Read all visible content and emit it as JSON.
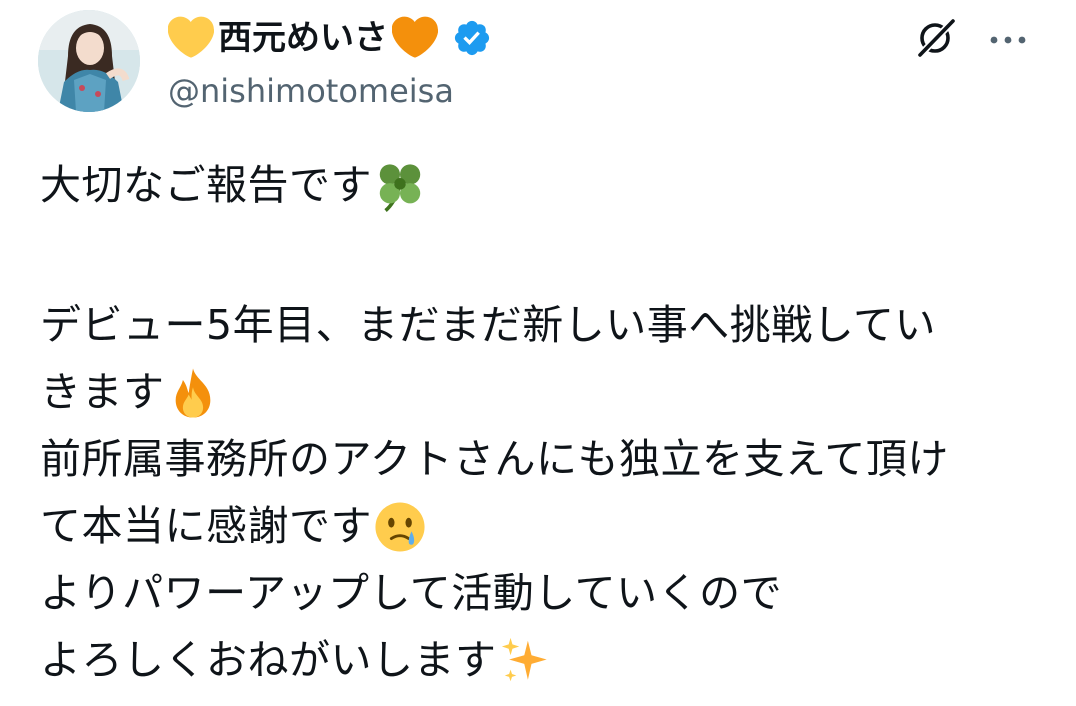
{
  "author": {
    "display_name": "西元めいさ",
    "handle": "@nishimotomeisa",
    "verified": true,
    "heart_left_color": "#FFCC4D",
    "heart_right_color": "#F4900C",
    "verified_color": "#1D9BF0"
  },
  "header_actions": {
    "grok_icon": "grok-icon",
    "more_icon": "more-horizontal-icon"
  },
  "tweet": {
    "lines": [
      "大切なご報告です",
      "",
      "デビュー5年目、まだまだ新しい事へ挑戦してい",
      "きます",
      "前所属事務所のアクトさんにも独立を支えて頂け",
      "て本当に感謝です",
      "よりパワーアップして活動していくので",
      "よろしくおねがいします"
    ],
    "emojis": {
      "line_0": "four-leaf-clover-emoji",
      "line_3": "fire-emoji",
      "line_5": "face-holding-back-tears-emoji",
      "line_7": "sparkles-emoji"
    }
  }
}
